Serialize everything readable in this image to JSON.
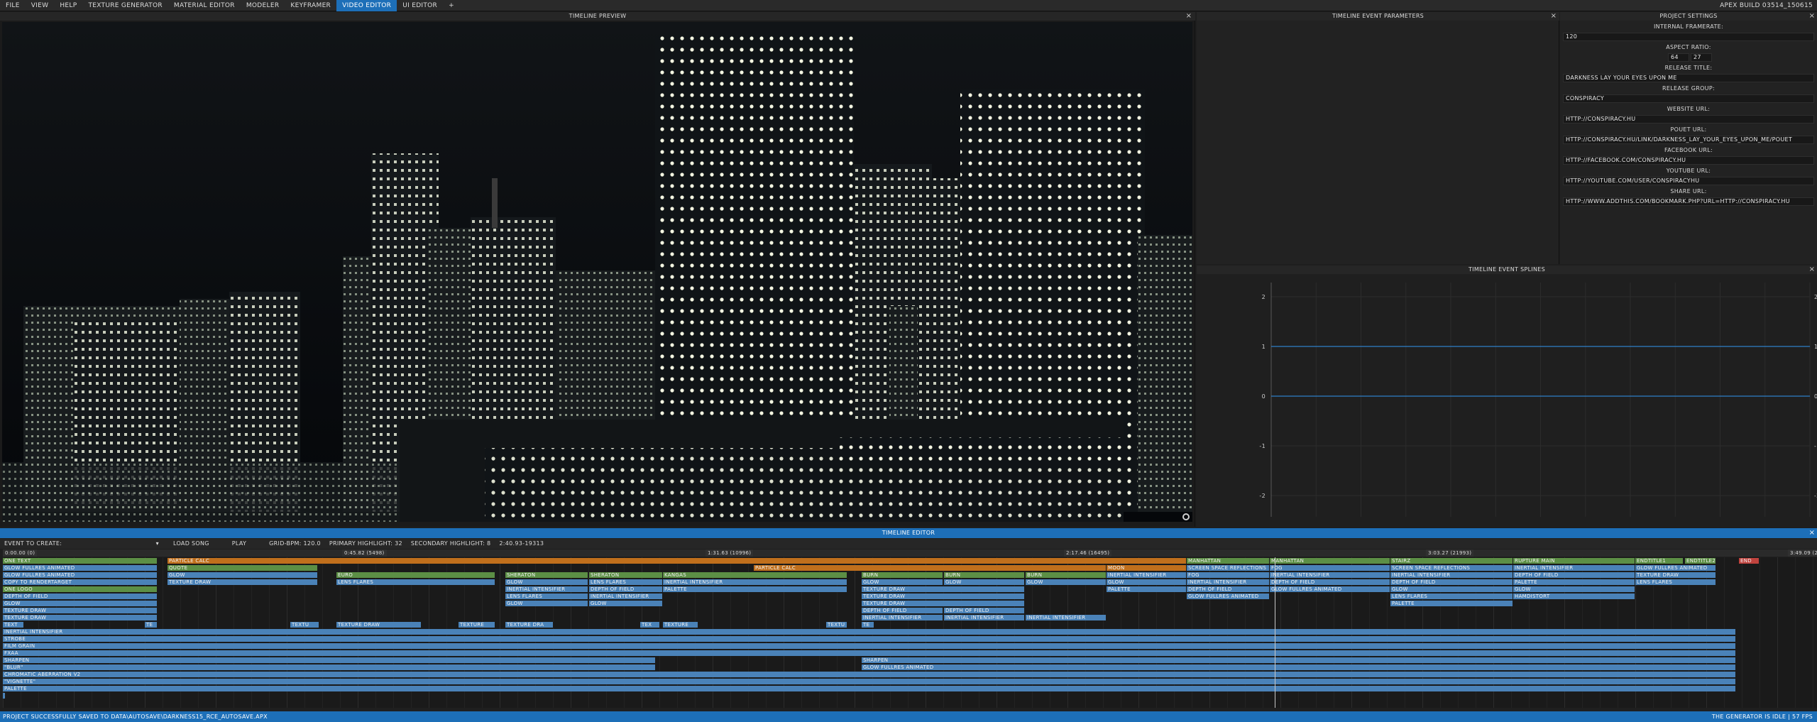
{
  "menu": {
    "items": [
      "FILE",
      "VIEW",
      "HELP",
      "TEXTURE GENERATOR",
      "MATERIAL EDITOR",
      "MODELER",
      "KEYFRAMER",
      "VIDEO EDITOR",
      "UI EDITOR",
      "+"
    ],
    "active_index": 7,
    "build": "APEX BUILD 03514_150615"
  },
  "preview": {
    "title": "TIMELINE PREVIEW",
    "close": "×"
  },
  "params": {
    "title": "TIMELINE EVENT PARAMETERS",
    "close": "×"
  },
  "settings": {
    "title": "PROJECT SETTINGS",
    "close": "×",
    "framerate_label": "INTERNAL FRAMERATE:",
    "framerate": "120",
    "aspect_label": "ASPECT RATIO:",
    "aspect_w": "64",
    "aspect_h": "27",
    "release_title_label": "RELEASE TITLE:",
    "release_title": "DARKNESS LAY YOUR EYES UPON ME",
    "release_group_label": "RELEASE GROUP:",
    "release_group": "CONSPIRACY",
    "website_label": "WEBSITE URL:",
    "website": "HTTP://CONSPIRACY.HU",
    "pouet_label": "POUET URL:",
    "pouet": "HTTP://CONSPIRACY.HU/LINK/DARKNESS_LAY_YOUR_EYES_UPON_ME/POUET",
    "facebook_label": "FACEBOOK URL:",
    "facebook": "HTTP://FACEBOOK.COM/CONSPIRACY.HU",
    "youtube_label": "YOUTUBE URL:",
    "youtube": "HTTP://YOUTUBE.COM/USER/CONSPIRACYHU",
    "share_label": "SHARE URL:",
    "share": "HTTP://WWW.ADDTHIS.COM/BOOKMARK.PHP?URL=HTTP://CONSPIRACY.HU"
  },
  "splines": {
    "title": "TIMELINE EVENT SPLINES",
    "close": "×",
    "y_ticks": [
      "2",
      "1",
      "0",
      "-1",
      "-2"
    ]
  },
  "timeline": {
    "title": "TIMELINE EDITOR",
    "close": "×",
    "event_to_create": "EVENT TO CREATE:",
    "load_song": "LOAD SONG",
    "play": "PLAY",
    "grid_bpm": "GRID-BPM: 120.0",
    "primary": "PRIMARY HIGHLIGHT: 32",
    "secondary": "SECONDARY HIGHLIGHT: 8",
    "time_range": "2:40.93-19313",
    "ruler": [
      "0:00.00 (0)",
      "0:45.82 (5498)",
      "1:31.63 (10996)",
      "2:17.46 (16495)",
      "3:03.27 (21993)",
      "3:49.09 (27490)"
    ],
    "events": [
      {
        "l": "ONE TEXT",
        "r": 0,
        "s": 0,
        "e": 218,
        "c": "green"
      },
      {
        "l": "PARTICLE CALC",
        "r": 0,
        "s": 232,
        "e": 1668,
        "c": "orange"
      },
      {
        "l": "MANHATTAN",
        "r": 0,
        "s": 1668,
        "e": 1785,
        "c": "green"
      },
      {
        "l": "MANHATTAN",
        "r": 0,
        "s": 1785,
        "e": 1955,
        "c": "green"
      },
      {
        "l": "STAIRZ",
        "r": 0,
        "s": 1955,
        "e": 2128,
        "c": "green"
      },
      {
        "l": "RUPTURE MAIN",
        "r": 0,
        "s": 2128,
        "e": 2300,
        "c": "green"
      },
      {
        "l": "ENDTITLE1",
        "r": 0,
        "s": 2300,
        "e": 2368,
        "c": "green"
      },
      {
        "l": "ENDTITLE2",
        "r": 0,
        "s": 2370,
        "e": 2414,
        "c": "green"
      },
      {
        "l": "END",
        "r": 0,
        "s": 2446,
        "e": 2475,
        "c": "red"
      },
      {
        "l": "GLOW FULLRES ANIMATED",
        "r": 1,
        "s": 0,
        "e": 218,
        "c": "blue"
      },
      {
        "l": "QUOTE",
        "r": 1,
        "s": 232,
        "e": 444,
        "c": "green"
      },
      {
        "l": "PARTICLE CALC",
        "r": 1,
        "s": 1058,
        "e": 1555,
        "c": "orange"
      },
      {
        "l": "MOON",
        "r": 1,
        "s": 1555,
        "e": 1668,
        "c": "orange"
      },
      {
        "l": "SCREEN SPACE REFLECTIONS",
        "r": 1,
        "s": 1668,
        "e": 1785,
        "c": "blue"
      },
      {
        "l": "FOG",
        "r": 1,
        "s": 1785,
        "e": 1955,
        "c": "blue"
      },
      {
        "l": "SCREEN SPACE REFLECTIONS",
        "r": 1,
        "s": 1955,
        "e": 2128,
        "c": "blue"
      },
      {
        "l": "INERTIAL INTENSIFIER",
        "r": 1,
        "s": 2128,
        "e": 2300,
        "c": "blue"
      },
      {
        "l": "GLOW FULLRES ANIMATED",
        "r": 1,
        "s": 2300,
        "e": 2414,
        "c": "blue"
      },
      {
        "l": "GLOW FULLRES ANIMATED",
        "r": 2,
        "s": 0,
        "e": 218,
        "c": "blue"
      },
      {
        "l": "GLOW",
        "r": 2,
        "s": 232,
        "e": 444,
        "c": "blue"
      },
      {
        "l": "EURO",
        "r": 2,
        "s": 470,
        "e": 694,
        "c": "green"
      },
      {
        "l": "SHERATON",
        "r": 2,
        "s": 708,
        "e": 825,
        "c": "green"
      },
      {
        "l": "SHERATON",
        "r": 2,
        "s": 826,
        "e": 930,
        "c": "green"
      },
      {
        "l": "KANGAS",
        "r": 2,
        "s": 930,
        "e": 1190,
        "c": "green"
      },
      {
        "l": "BURN",
        "r": 2,
        "s": 1210,
        "e": 1325,
        "c": "green"
      },
      {
        "l": "BURN",
        "r": 2,
        "s": 1326,
        "e": 1440,
        "c": "green"
      },
      {
        "l": "BURN",
        "r": 2,
        "s": 1441,
        "e": 1555,
        "c": "green"
      },
      {
        "l": "INERTIAL INTENSIFIER",
        "r": 2,
        "s": 1555,
        "e": 1668,
        "c": "blue"
      },
      {
        "l": "FOG",
        "r": 2,
        "s": 1668,
        "e": 1785,
        "c": "blue"
      },
      {
        "l": "INERTIAL INTENSIFIER",
        "r": 2,
        "s": 1785,
        "e": 1955,
        "c": "blue"
      },
      {
        "l": "INERTIAL INTENSIFIER",
        "r": 2,
        "s": 1955,
        "e": 2128,
        "c": "blue"
      },
      {
        "l": "DEPTH OF FIELD",
        "r": 2,
        "s": 2128,
        "e": 2300,
        "c": "blue"
      },
      {
        "l": "TEXTURE DRAW",
        "r": 2,
        "s": 2300,
        "e": 2414,
        "c": "blue"
      },
      {
        "l": "COPY TO RENDERTARGET",
        "r": 3,
        "s": 0,
        "e": 218,
        "c": "blue"
      },
      {
        "l": "TEXTURE DRAW",
        "r": 3,
        "s": 232,
        "e": 444,
        "c": "blue"
      },
      {
        "l": "LENS FLARES",
        "r": 3,
        "s": 470,
        "e": 694,
        "c": "blue"
      },
      {
        "l": "GLOW",
        "r": 3,
        "s": 708,
        "e": 825,
        "c": "blue"
      },
      {
        "l": "LENS FLARES",
        "r": 3,
        "s": 826,
        "e": 930,
        "c": "blue"
      },
      {
        "l": "INERTIAL INTENSIFIER",
        "r": 3,
        "s": 930,
        "e": 1190,
        "c": "blue"
      },
      {
        "l": "GLOW",
        "r": 3,
        "s": 1210,
        "e": 1325,
        "c": "blue"
      },
      {
        "l": "GLOW",
        "r": 3,
        "s": 1326,
        "e": 1440,
        "c": "blue"
      },
      {
        "l": "GLOW",
        "r": 3,
        "s": 1441,
        "e": 1555,
        "c": "blue"
      },
      {
        "l": "GLOW",
        "r": 3,
        "s": 1555,
        "e": 1668,
        "c": "blue"
      },
      {
        "l": "INERTIAL INTENSIFIER",
        "r": 3,
        "s": 1668,
        "e": 1785,
        "c": "blue"
      },
      {
        "l": "DEPTH OF FIELD",
        "r": 3,
        "s": 1785,
        "e": 1955,
        "c": "blue"
      },
      {
        "l": "DEPTH OF FIELD",
        "r": 3,
        "s": 1955,
        "e": 2128,
        "c": "blue"
      },
      {
        "l": "PALETTE",
        "r": 3,
        "s": 2128,
        "e": 2300,
        "c": "blue"
      },
      {
        "l": "LENS FLARES",
        "r": 3,
        "s": 2300,
        "e": 2414,
        "c": "blue"
      },
      {
        "l": "ONE LOGO",
        "r": 4,
        "s": 0,
        "e": 218,
        "c": "green"
      },
      {
        "l": "INERTIAL INTENSIFIER",
        "r": 4,
        "s": 708,
        "e": 825,
        "c": "blue"
      },
      {
        "l": "DEPTH OF FIELD",
        "r": 4,
        "s": 826,
        "e": 930,
        "c": "blue"
      },
      {
        "l": "PALETTE",
        "r": 4,
        "s": 930,
        "e": 1190,
        "c": "blue"
      },
      {
        "l": "TEXTURE DRAW",
        "r": 4,
        "s": 1210,
        "e": 1440,
        "c": "blue"
      },
      {
        "l": "PALETTE",
        "r": 4,
        "s": 1555,
        "e": 1668,
        "c": "blue"
      },
      {
        "l": "DEPTH OF FIELD",
        "r": 4,
        "s": 1668,
        "e": 1785,
        "c": "blue"
      },
      {
        "l": "GLOW FULLRES ANIMATED",
        "r": 4,
        "s": 1785,
        "e": 1955,
        "c": "blue"
      },
      {
        "l": "GLOW",
        "r": 4,
        "s": 1955,
        "e": 2128,
        "c": "blue"
      },
      {
        "l": "GLOW",
        "r": 4,
        "s": 2128,
        "e": 2300,
        "c": "blue"
      },
      {
        "l": "DEPTH OF FIELD",
        "r": 5,
        "s": 0,
        "e": 218,
        "c": "blue"
      },
      {
        "l": "LENS FLARES",
        "r": 5,
        "s": 708,
        "e": 825,
        "c": "blue"
      },
      {
        "l": "INERTIAL INTENSIFIER",
        "r": 5,
        "s": 826,
        "e": 930,
        "c": "blue"
      },
      {
        "l": "TEXTURE DRAW",
        "r": 5,
        "s": 1210,
        "e": 1440,
        "c": "blue"
      },
      {
        "l": "GLOW FULLRES ANIMATED",
        "r": 5,
        "s": 1668,
        "e": 1785,
        "c": "blue"
      },
      {
        "l": "LENS FLARES",
        "r": 5,
        "s": 1955,
        "e": 2128,
        "c": "blue"
      },
      {
        "l": "HAMDISTORT",
        "r": 5,
        "s": 2128,
        "e": 2300,
        "c": "blue"
      },
      {
        "l": "GLOW",
        "r": 6,
        "s": 0,
        "e": 218,
        "c": "blue"
      },
      {
        "l": "GLOW",
        "r": 6,
        "s": 708,
        "e": 825,
        "c": "blue"
      },
      {
        "l": "GLOW",
        "r": 6,
        "s": 826,
        "e": 930,
        "c": "blue"
      },
      {
        "l": "TEXTURE DRAW",
        "r": 6,
        "s": 1210,
        "e": 1440,
        "c": "blue"
      },
      {
        "l": "PALETTE",
        "r": 6,
        "s": 1955,
        "e": 2128,
        "c": "blue"
      },
      {
        "l": "TEXTURE DRAW",
        "r": 7,
        "s": 0,
        "e": 218,
        "c": "blue"
      },
      {
        "l": "DEPTH OF FIELD",
        "r": 7,
        "s": 1210,
        "e": 1325,
        "c": "blue"
      },
      {
        "l": "DEPTH OF FIELD",
        "r": 7,
        "s": 1326,
        "e": 1440,
        "c": "blue"
      },
      {
        "l": "TEXTURE DRAW",
        "r": 8,
        "s": 0,
        "e": 218,
        "c": "blue"
      },
      {
        "l": "INERTIAL INTENSIFIER",
        "r": 8,
        "s": 1210,
        "e": 1325,
        "c": "blue"
      },
      {
        "l": "INERTIAL INTENSIFIER",
        "r": 8,
        "s": 1326,
        "e": 1440,
        "c": "blue"
      },
      {
        "l": "INERTIAL INTENSIFIER",
        "r": 8,
        "s": 1441,
        "e": 1555,
        "c": "blue"
      },
      {
        "l": "TEXT",
        "r": 9,
        "s": 0,
        "e": 30,
        "c": "blue"
      },
      {
        "l": "TE",
        "r": 9,
        "s": 200,
        "e": 218,
        "c": "blue"
      },
      {
        "l": "TEXTU",
        "r": 9,
        "s": 405,
        "e": 446,
        "c": "blue"
      },
      {
        "l": "TEXTURE DRAW",
        "r": 9,
        "s": 470,
        "e": 590,
        "c": "blue"
      },
      {
        "l": "TEXTURE",
        "r": 9,
        "s": 642,
        "e": 694,
        "c": "blue"
      },
      {
        "l": "TEXTURE DRA",
        "r": 9,
        "s": 708,
        "e": 776,
        "c": "blue"
      },
      {
        "l": "TEX",
        "r": 9,
        "s": 898,
        "e": 926,
        "c": "blue"
      },
      {
        "l": "TEXTURE",
        "r": 9,
        "s": 930,
        "e": 980,
        "c": "blue"
      },
      {
        "l": "TEXTU",
        "r": 9,
        "s": 1160,
        "e": 1190,
        "c": "blue"
      },
      {
        "l": "TE",
        "r": 9,
        "s": 1210,
        "e": 1228,
        "c": "blue"
      },
      {
        "l": "INERTIAL INTENSIFIER",
        "r": 10,
        "s": 0,
        "e": 2442,
        "c": "blue"
      },
      {
        "l": "STROBE",
        "r": 11,
        "s": 0,
        "e": 2442,
        "c": "blue"
      },
      {
        "l": "FILM GRAIN",
        "r": 12,
        "s": 0,
        "e": 2442,
        "c": "blue"
      },
      {
        "l": "FXAA",
        "r": 13,
        "s": 0,
        "e": 2442,
        "c": "blue"
      },
      {
        "l": "SHARPEN",
        "r": 14,
        "s": 0,
        "e": 920,
        "c": "blue"
      },
      {
        "l": "SHARPEN",
        "r": 14,
        "s": 1210,
        "e": 2442,
        "c": "blue"
      },
      {
        "l": "\"BLUR\"",
        "r": 15,
        "s": 0,
        "e": 920,
        "c": "blue"
      },
      {
        "l": "GLOW FULLRES ANIMATED",
        "r": 15,
        "s": 1210,
        "e": 2442,
        "c": "blue"
      },
      {
        "l": "CHROMATIC ABERRATION V2",
        "r": 16,
        "s": 0,
        "e": 2442,
        "c": "blue"
      },
      {
        "l": "\"VIGNETTE\"",
        "r": 17,
        "s": 0,
        "e": 2442,
        "c": "blue"
      },
      {
        "l": "PALETTE",
        "r": 18,
        "s": 0,
        "e": 2442,
        "c": "blue"
      },
      {
        "l": "1",
        "r": 19,
        "s": 0,
        "e": 4,
        "c": "blue"
      }
    ]
  },
  "status": {
    "message": "PROJECT SUCCESSFULLY SAVED TO DATA\\AUTOSAVE\\DARKNESS15_RCE_AUTOSAVE.APX",
    "right": "THE GENERATOR IS IDLE | 57 FPS"
  },
  "colors": {
    "accent": "#1d6fb8",
    "event_blue": "#4a82b8",
    "event_green": "#5c8f45",
    "event_orange": "#c06f1c",
    "event_red": "#c0433e"
  }
}
